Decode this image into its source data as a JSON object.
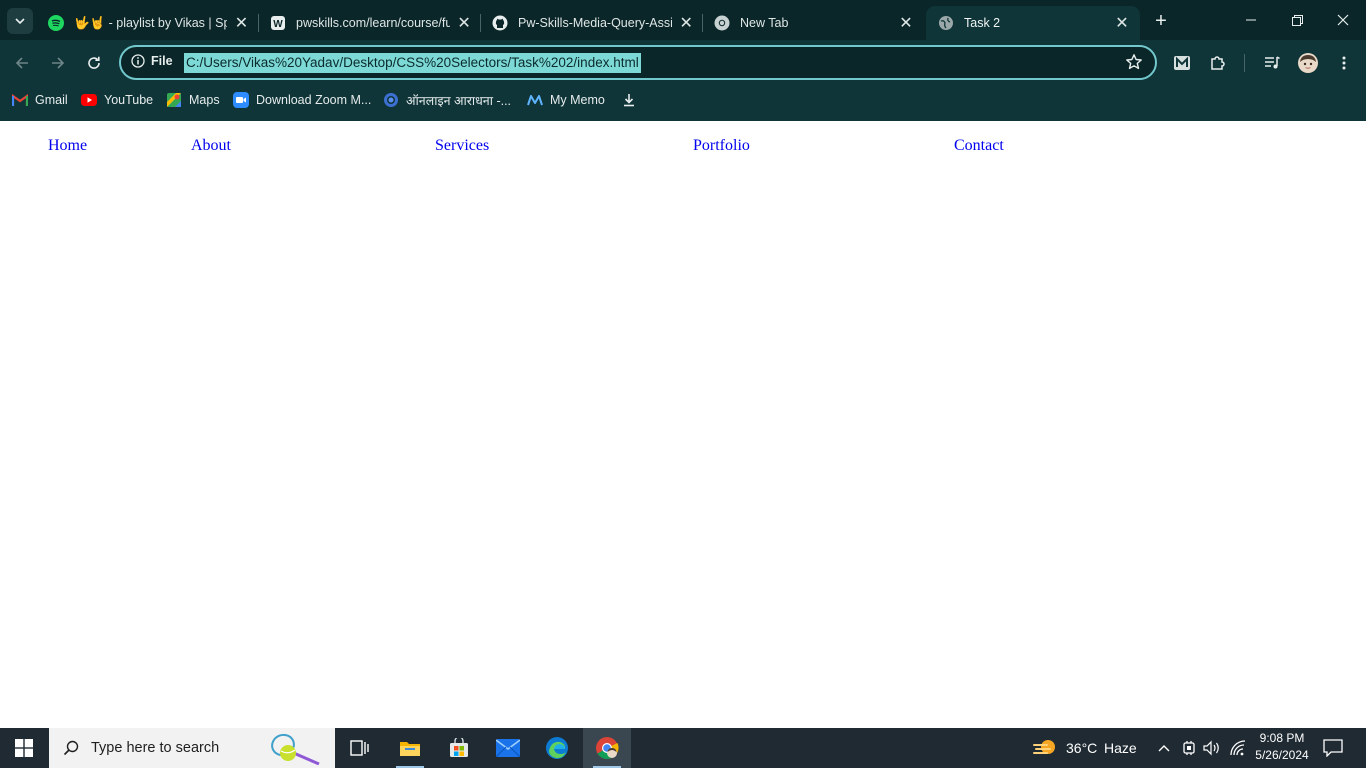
{
  "browser": {
    "tabs": [
      {
        "title": "🤟🤘 - playlist by Vikas | Spotify",
        "favicon": "spotify-icon",
        "active": false
      },
      {
        "title": "pwskills.com/learn/course/full-stack",
        "favicon": "pwskills-icon",
        "active": false
      },
      {
        "title": "Pw-Skills-Media-Query-Assignment",
        "favicon": "github-icon",
        "active": false
      },
      {
        "title": "New Tab",
        "favicon": "chrome-icon",
        "active": false
      },
      {
        "title": "Task 2",
        "favicon": "globe-icon",
        "active": true
      }
    ],
    "new_tab_label": "+",
    "address_bar": {
      "security_label": "File",
      "url": "C:/Users/Vikas%20Yadav/Desktop/CSS%20Selectors/Task%202/index.html"
    },
    "bookmarks": [
      {
        "label": "Gmail",
        "icon": "gmail-icon"
      },
      {
        "label": "YouTube",
        "icon": "youtube-icon"
      },
      {
        "label": "Maps",
        "icon": "maps-icon"
      },
      {
        "label": "Download Zoom M...",
        "icon": "zoom-icon"
      },
      {
        "label": "ऑनलाइन आराधना -...",
        "icon": "circle-icon"
      },
      {
        "label": "My Memo",
        "icon": "mymemo-icon"
      }
    ],
    "accent_color": "#7dd9d6",
    "frame_color": "#0f3538"
  },
  "page": {
    "nav": [
      {
        "label": "Home"
      },
      {
        "label": "About"
      },
      {
        "label": "Services"
      },
      {
        "label": "Portfolio"
      },
      {
        "label": "Contact"
      }
    ],
    "link_color": "#0000ee"
  },
  "taskbar": {
    "search_placeholder": "Type here to search",
    "weather": {
      "temp": "36°C",
      "condition": "Haze"
    },
    "clock": {
      "time": "9:08 PM",
      "date": "5/26/2024"
    },
    "apps": [
      "task-view-icon",
      "file-explorer-icon",
      "microsoft-store-icon",
      "mail-icon",
      "edge-icon",
      "chrome-icon"
    ]
  }
}
